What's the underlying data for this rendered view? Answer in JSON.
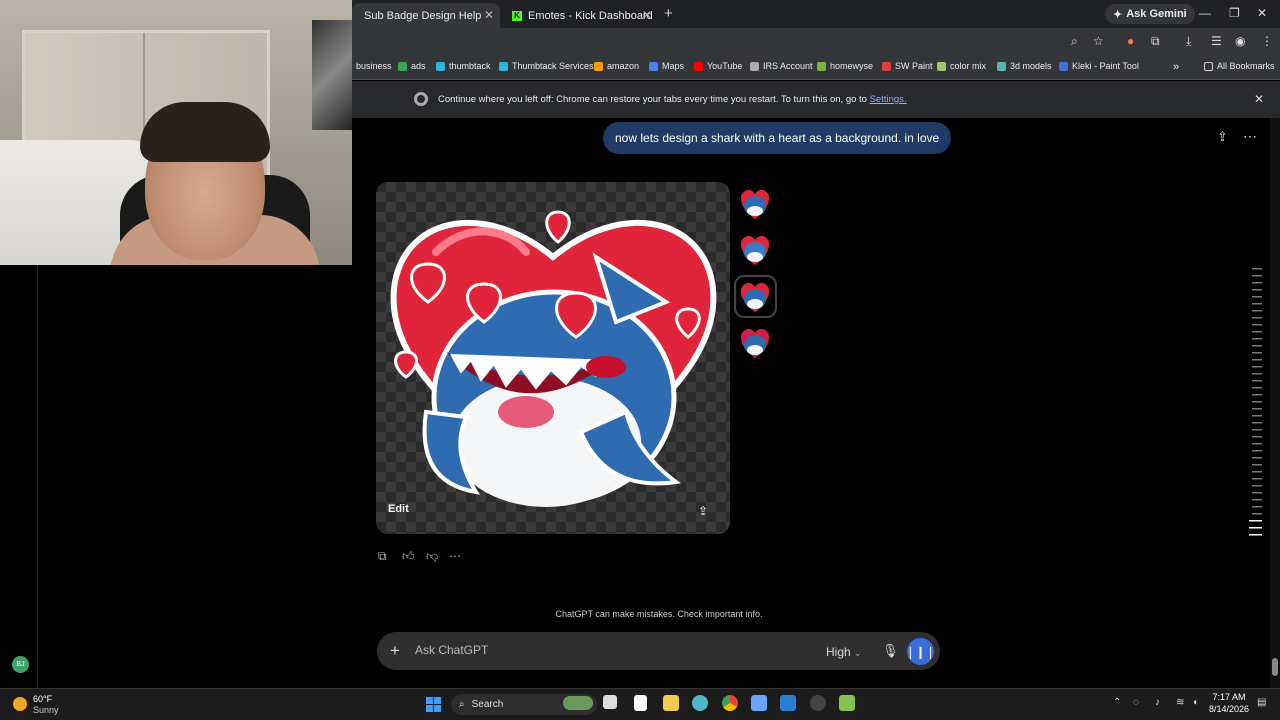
{
  "browser": {
    "tabs": [
      {
        "label": "Sub Badge Design Help",
        "active": true
      },
      {
        "label": "Emotes - Kick Dashboard",
        "active": false
      }
    ],
    "ask_gemini": "Ask Gemini",
    "bookmarks": [
      {
        "label": "business",
        "color": "#888888"
      },
      {
        "label": "ads",
        "color": "#34a853"
      },
      {
        "label": "thumbtack",
        "color": "#2bb5d8"
      },
      {
        "label": "Thumbtack Services",
        "color": "#2bb5d8"
      },
      {
        "label": "amazon",
        "color": "#ff9900"
      },
      {
        "label": "Maps",
        "color": "#4285f4"
      },
      {
        "label": "YouTube",
        "color": "#ff0000"
      },
      {
        "label": "IRS Account",
        "color": "#aaaaaa"
      },
      {
        "label": "homewyse",
        "color": "#7cb342"
      },
      {
        "label": "SW Paint",
        "color": "#e04040"
      },
      {
        "label": "color mix",
        "color": "#9ccc65"
      },
      {
        "label": "3d models",
        "color": "#5fb3b3"
      },
      {
        "label": "Kleki - Paint Tool",
        "color": "#3f6fd8"
      }
    ],
    "all_bookmarks": "All Bookmarks",
    "infobar": {
      "text": "Continue where you left off: Chrome can restore your tabs every time you restart. To turn this on, go to",
      "link": "Settings."
    }
  },
  "chat": {
    "user_message": "now lets design a shark with a heart as a background. in love",
    "edit_label": "Edit",
    "disclaimer": "ChatGPT can make mistakes. Check important info.",
    "composer_placeholder": "Ask ChatGPT",
    "model": "High",
    "user_initials": "BJ"
  },
  "taskbar": {
    "weather_temp": "60°F",
    "weather_desc": "Sunny",
    "search_label": "Search",
    "time": "7:17 AM",
    "date": "8/14/2026"
  },
  "colors": {
    "accent": "#3a6cdc",
    "user_bubble": "#1f3b66",
    "heart_red": "#e0253a",
    "shark_blue": "#2f6bb0"
  }
}
